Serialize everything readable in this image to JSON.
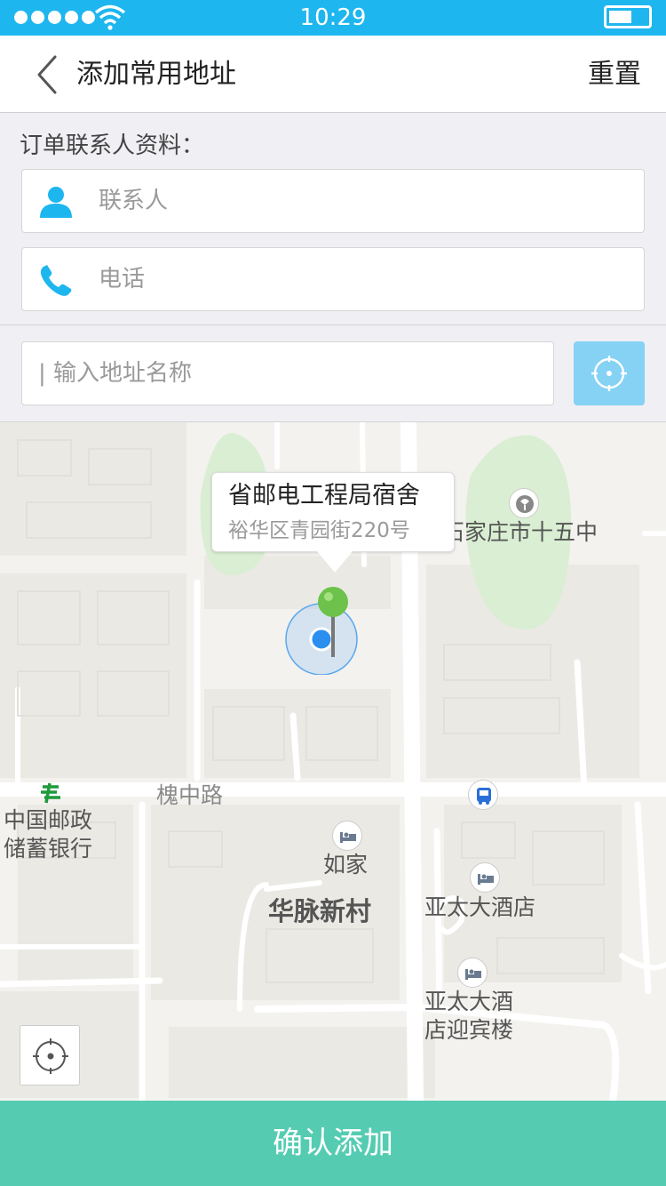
{
  "status_bar": {
    "time": "10:29",
    "signal_dots": 5,
    "battery_level": 0.6
  },
  "nav": {
    "title": "添加常用地址",
    "reset_label": "重置",
    "back_icon": "chevron-left-icon"
  },
  "contact": {
    "section_label": "订单联系人资料：",
    "name_placeholder": "联系人",
    "name_value": "",
    "name_icon": "person-icon",
    "phone_placeholder": "电话",
    "phone_value": "",
    "phone_icon": "phone-icon"
  },
  "address": {
    "search_placeholder": "| 输入地址名称",
    "search_value": "",
    "locate_icon": "crosshair-icon"
  },
  "map": {
    "callout_title": "省邮电工程局宿舍",
    "callout_subtitle": "裕华区青园街220号",
    "labels": {
      "school": "石家庄市十五中",
      "road": "槐中路",
      "bank_line1": "中国邮政",
      "bank_line2": "储蓄银行",
      "hotel1": "如家",
      "village": "华脉新村",
      "hotel2": "亚太大酒店",
      "hotel3_line1": "亚太大酒",
      "hotel3_line2": "店迎宾楼"
    },
    "icons": {
      "school": "school-icon",
      "bank": "post-office-icon",
      "bus": "bus-stop-icon",
      "hotel": "hotel-bed-icon",
      "pin": "map-pin-icon",
      "locate": "crosshair-icon"
    }
  },
  "colors": {
    "status_bar": "#1eb6ef",
    "icon_blue": "#1eb6ef",
    "locate_button": "#85d2f5",
    "confirm_button": "#55ccb2",
    "pin_green": "#6cc24a",
    "location_dot": "#2b8ff0",
    "park_green": "#d9eed2"
  },
  "footer": {
    "confirm_label": "确认添加"
  }
}
